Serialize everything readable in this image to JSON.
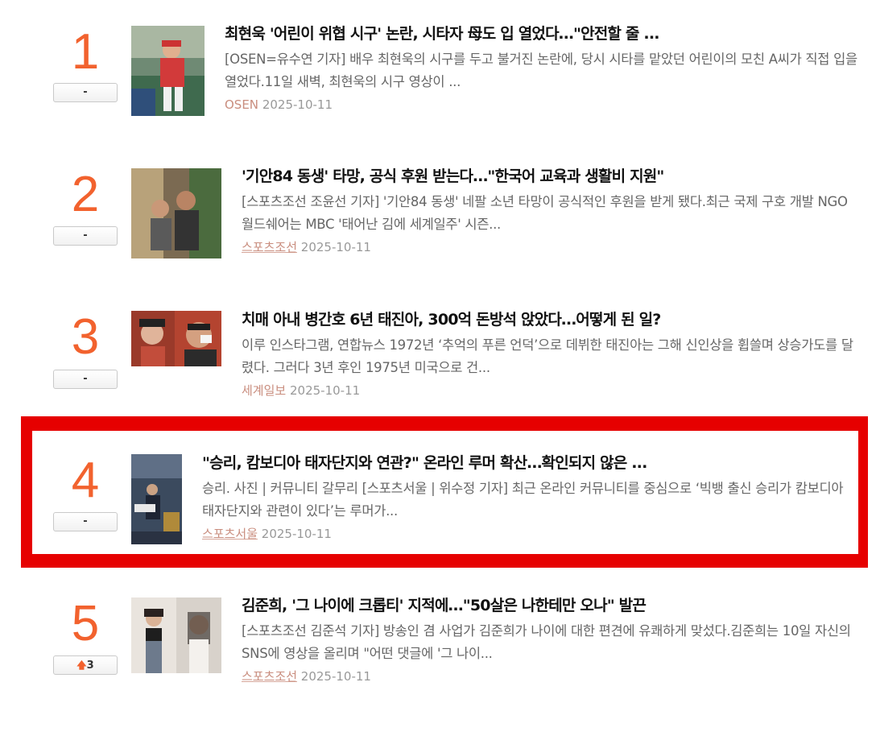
{
  "items": [
    {
      "rank": "1",
      "change": "-",
      "title": "최현욱 '어린이 위협 시구' 논란, 시타자 母도 입 열었다…\"안전할 줄 ...",
      "summary": "[OSEN=유수연 기자] 배우 최현욱의 시구를 두고 불거진 논란에, 당시 시타를 맡았던 어린이의 모친 A씨가 직접 입을 열었다.11일 새벽, 최현욱의 시구 영상이 ...",
      "source": "OSEN",
      "date": "2025-10-11"
    },
    {
      "rank": "2",
      "change": "-",
      "title": "'기안84 동생' 타망, 공식 후원 받는다…\"한국어 교육과 생활비 지원\"",
      "summary": "[스포츠조선 조윤선 기자] '기안84 동생' 네팔 소년 타망이 공식적인 후원을 받게 됐다.최근 국제 구호 개발 NGO 월드쉐어는 MBC '태어난 김에 세계일주' 시즌...",
      "source": "스포츠조선",
      "date": "2025-10-11"
    },
    {
      "rank": "3",
      "change": "-",
      "title": "치매 아내 병간호 6년 태진아, 300억 돈방석 앉았다…어떻게 된 일?",
      "summary": "이루 인스타그램, 연합뉴스 1972년 ‘추억의 푸른 언덕’으로 데뷔한 태진아는 그해 신인상을 휩쓸며 상승가도를 달렸다. 그러다 3년 후인 1975년 미국으로 건...",
      "source": "세계일보",
      "date": "2025-10-11"
    },
    {
      "rank": "4",
      "change": "-",
      "title": "\"승리, 캄보디아 태자단지와 연관?\" 온라인 루머 확산…확인되지 않은 ...",
      "summary": "승리. 사진 | 커뮤니티 갈무리 [스포츠서울 | 위수정 기자] 최근 온라인 커뮤니티를 중심으로 ‘빅뱅 출신 승리가 캄보디아 태자단지와 관련이 있다’는 루머가...",
      "source": "스포츠서울",
      "date": "2025-10-11"
    },
    {
      "rank": "5",
      "change": "3",
      "change_icon": "arrow-up-icon",
      "title": "김준희, '그 나이에 크롭티' 지적에…\"50살은 나한테만 오나\" 발끈",
      "summary": "[스포츠조선 김준석 기자] 방송인 겸 사업가 김준희가 나이에 대한 편견에 유쾌하게 맞섰다.김준희는 10일 자신의 SNS에 영상을 올리며 \"어떤 댓글에 '그 나이...",
      "source": "스포츠조선",
      "date": "2025-10-11"
    }
  ],
  "colors": {
    "rank": "#f2622e",
    "highlight": "#e60000",
    "source": "#c98d7e"
  }
}
